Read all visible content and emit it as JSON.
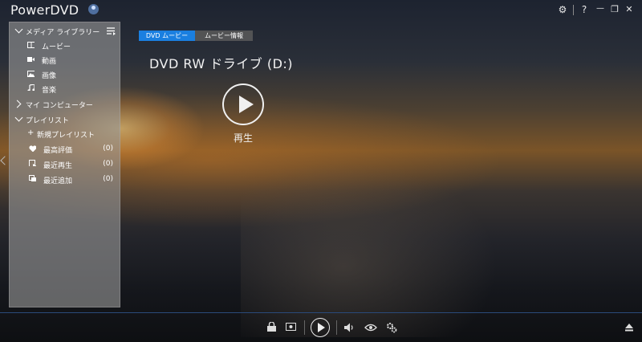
{
  "app": {
    "title": "PowerDVD"
  },
  "titlebar": {
    "settings": "⚙",
    "help": "?",
    "minimize": "—",
    "restore": "❐",
    "close": "✕"
  },
  "sidebar": {
    "media_library": "メディア ライブラリー",
    "items": [
      {
        "label": "ムービー",
        "icon": "movie-icon"
      },
      {
        "label": "動画",
        "icon": "video-camera-icon"
      },
      {
        "label": "画像",
        "icon": "image-icon"
      },
      {
        "label": "音楽",
        "icon": "music-note-icon"
      }
    ],
    "my_computer": "マイ コンピューター",
    "playlist": "プレイリスト",
    "new_playlist": "新規プレイリスト",
    "playlists": [
      {
        "label": "最高評価",
        "count": "(0)",
        "icon": "heart-icon"
      },
      {
        "label": "最近再生",
        "count": "(0)",
        "icon": "recent-play-icon"
      },
      {
        "label": "最近追加",
        "count": "(0)",
        "icon": "recent-add-icon"
      }
    ]
  },
  "tabs": {
    "dvd_movie": "DVD ムービー",
    "movie_info": "ムービー情報"
  },
  "main": {
    "drive_title": "DVD RW ドライブ (D:)",
    "play_label": "再生"
  },
  "colors": {
    "accent": "#1a7fe0"
  }
}
